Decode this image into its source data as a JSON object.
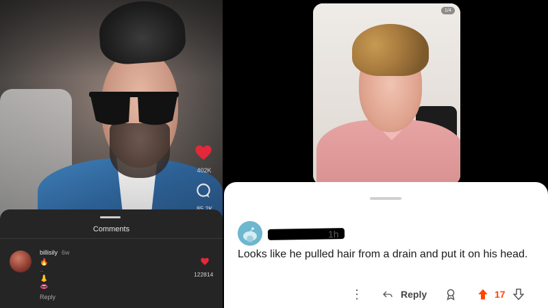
{
  "left_app": {
    "like_count": "402K",
    "comment_count_cut": "85.2K",
    "comments_title": "Comments",
    "comment": {
      "username": "billisily",
      "time_ago": "6w",
      "emojis": [
        "🔥",
        "...",
        "👃",
        "👄"
      ],
      "reply_label": "Reply",
      "like_count": "122814"
    }
  },
  "right_app": {
    "pager": "1/4",
    "comment": {
      "time_ago": "1h",
      "text": "Looks like he pulled hair from a drain and put it on his head.",
      "reply_label": "Reply",
      "vote_count": "17"
    }
  },
  "colors": {
    "upvote_accent": "#ff4500",
    "left_heart": "#e2283a",
    "left_sheet_bg": "#252526",
    "right_card_bg": "#ffffff"
  },
  "icons": {
    "left_heart": "heart-icon",
    "left_comment": "comment-bubble-icon",
    "left_small_heart": "heart-icon",
    "right_more": "more-dots-icon",
    "right_reply": "reply-arrow-icon",
    "right_award": "award-icon",
    "right_upvote": "upvote-arrow-icon",
    "right_downvote": "downvote-arrow-icon"
  }
}
